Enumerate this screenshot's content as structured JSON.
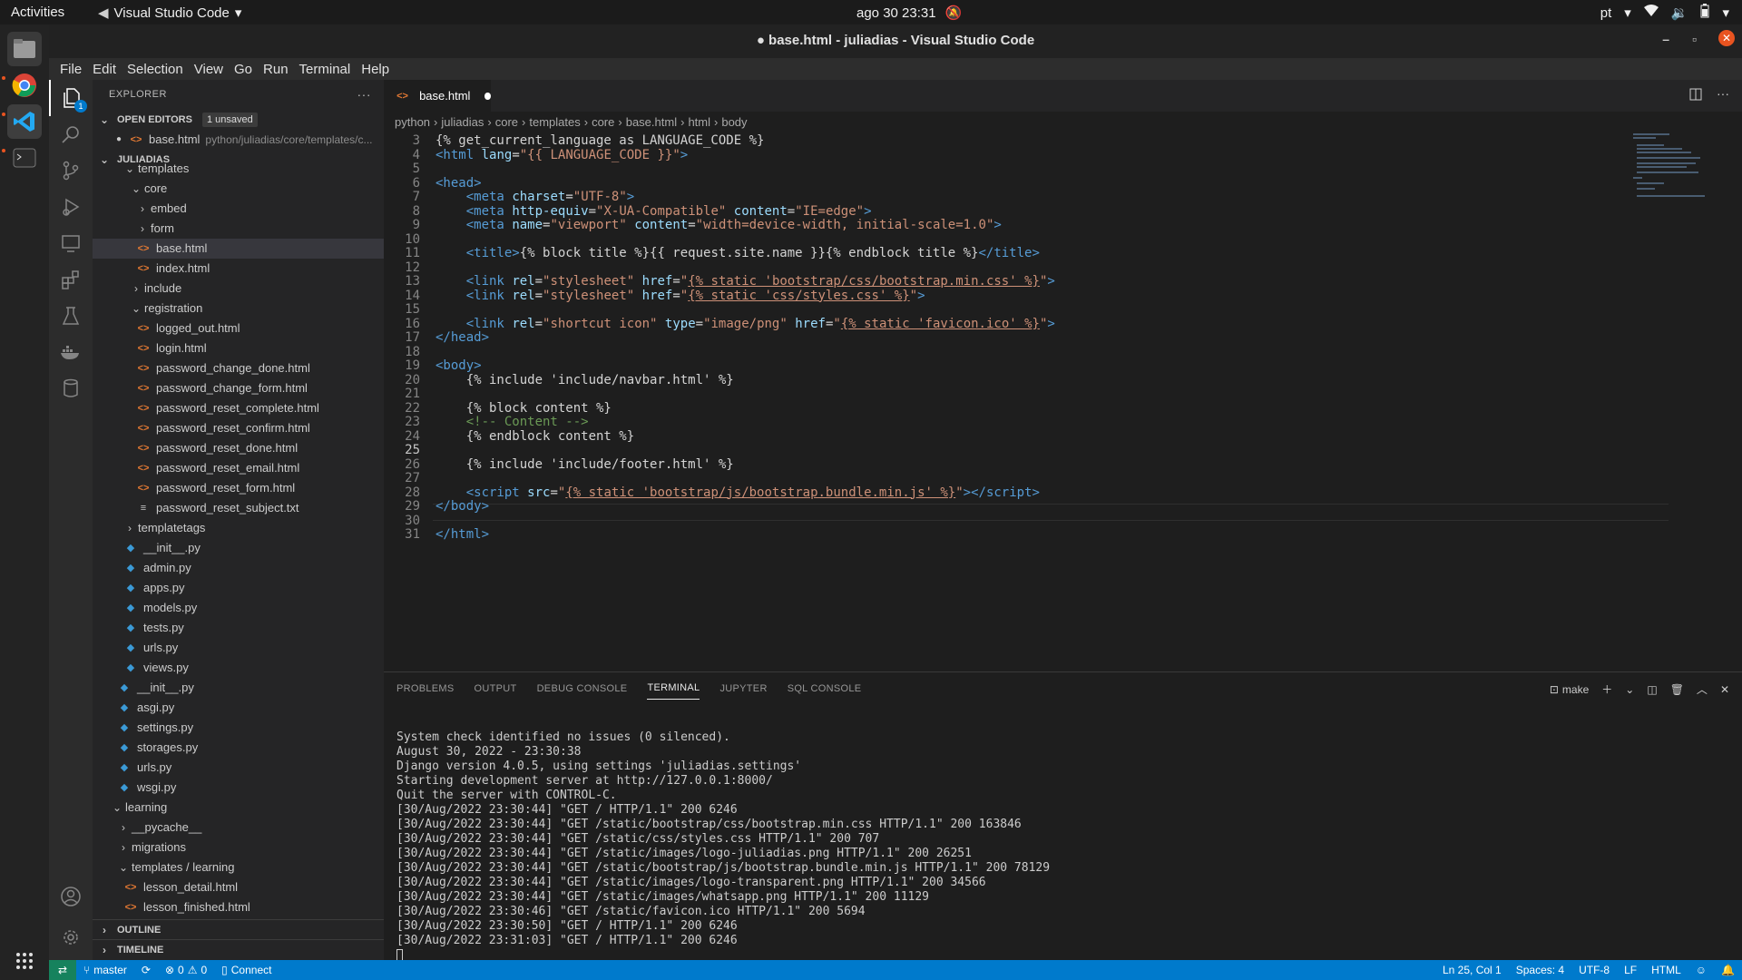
{
  "topbar": {
    "activities": "Activities",
    "app_name": "Visual Studio Code",
    "clock": "ago 30  23:31",
    "lang": "pt"
  },
  "window": {
    "title": "● base.html - juliadias - Visual Studio Code"
  },
  "menu": [
    "File",
    "Edit",
    "Selection",
    "View",
    "Go",
    "Run",
    "Terminal",
    "Help"
  ],
  "explorer": {
    "header": "EXPLORER",
    "open_editors_label": "OPEN EDITORS",
    "unsaved_badge": "1 unsaved",
    "open_file": "base.html",
    "open_file_path": "python/juliadias/core/templates/c...",
    "workspace_label": "JULIADIAS",
    "tree": [
      {
        "label": "templates",
        "kind": "folder-open",
        "depth": 2
      },
      {
        "label": "core",
        "kind": "folder-open",
        "depth": 3
      },
      {
        "label": "embed",
        "kind": "folder",
        "depth": 4
      },
      {
        "label": "form",
        "kind": "folder",
        "depth": 4
      },
      {
        "label": "base.html",
        "kind": "html",
        "depth": 4,
        "selected": true
      },
      {
        "label": "index.html",
        "kind": "html",
        "depth": 4
      },
      {
        "label": "include",
        "kind": "folder",
        "depth": 3
      },
      {
        "label": "registration",
        "kind": "folder-open",
        "depth": 3
      },
      {
        "label": "logged_out.html",
        "kind": "html",
        "depth": 4
      },
      {
        "label": "login.html",
        "kind": "html",
        "depth": 4
      },
      {
        "label": "password_change_done.html",
        "kind": "html",
        "depth": 4
      },
      {
        "label": "password_change_form.html",
        "kind": "html",
        "depth": 4
      },
      {
        "label": "password_reset_complete.html",
        "kind": "html",
        "depth": 4
      },
      {
        "label": "password_reset_confirm.html",
        "kind": "html",
        "depth": 4
      },
      {
        "label": "password_reset_done.html",
        "kind": "html",
        "depth": 4
      },
      {
        "label": "password_reset_email.html",
        "kind": "html",
        "depth": 4
      },
      {
        "label": "password_reset_form.html",
        "kind": "html",
        "depth": 4
      },
      {
        "label": "password_reset_subject.txt",
        "kind": "txt",
        "depth": 4
      },
      {
        "label": "templatetags",
        "kind": "folder",
        "depth": 2
      },
      {
        "label": "__init__.py",
        "kind": "py",
        "depth": 2
      },
      {
        "label": "admin.py",
        "kind": "py",
        "depth": 2
      },
      {
        "label": "apps.py",
        "kind": "py",
        "depth": 2
      },
      {
        "label": "models.py",
        "kind": "py",
        "depth": 2
      },
      {
        "label": "tests.py",
        "kind": "py",
        "depth": 2
      },
      {
        "label": "urls.py",
        "kind": "py",
        "depth": 2
      },
      {
        "label": "views.py",
        "kind": "py",
        "depth": 2
      },
      {
        "label": "__init__.py",
        "kind": "py",
        "depth": 1
      },
      {
        "label": "asgi.py",
        "kind": "py",
        "depth": 1
      },
      {
        "label": "settings.py",
        "kind": "py",
        "depth": 1
      },
      {
        "label": "storages.py",
        "kind": "py",
        "depth": 1
      },
      {
        "label": "urls.py",
        "kind": "py",
        "depth": 1
      },
      {
        "label": "wsgi.py",
        "kind": "py",
        "depth": 1
      },
      {
        "label": "learning",
        "kind": "folder-open",
        "depth": 0
      },
      {
        "label": "__pycache__",
        "kind": "folder",
        "depth": 1
      },
      {
        "label": "migrations",
        "kind": "folder",
        "depth": 1
      },
      {
        "label": "templates / learning",
        "kind": "folder-open",
        "depth": 1
      },
      {
        "label": "lesson_detail.html",
        "kind": "html",
        "depth": 2
      },
      {
        "label": "lesson_finished.html",
        "kind": "html",
        "depth": 2
      }
    ],
    "outline_label": "OUTLINE",
    "timeline_label": "TIMELINE"
  },
  "editor": {
    "tab_label": "base.html",
    "breadcrumbs": [
      "python",
      "juliadias",
      "core",
      "templates",
      "core",
      "base.html",
      "html",
      "body"
    ],
    "current_line": 25,
    "lines": [
      {
        "n": 3,
        "html": "{% get_current_language as LANGUAGE_CODE %}"
      },
      {
        "n": 4,
        "html": "<span class=\"t-tag\">&lt;html</span> <span class=\"t-attr\">lang</span>=<span class=\"t-str\">\"{{ LANGUAGE_CODE }}\"</span><span class=\"t-tag\">&gt;</span>"
      },
      {
        "n": 5,
        "html": ""
      },
      {
        "n": 6,
        "html": "<span class=\"t-tag\">&lt;head&gt;</span>"
      },
      {
        "n": 7,
        "html": "    <span class=\"t-tag\">&lt;meta</span> <span class=\"t-attr\">charset</span>=<span class=\"t-str\">\"UTF-8\"</span><span class=\"t-tag\">&gt;</span>"
      },
      {
        "n": 8,
        "html": "    <span class=\"t-tag\">&lt;meta</span> <span class=\"t-attr\">http-equiv</span>=<span class=\"t-str\">\"X-UA-Compatible\"</span> <span class=\"t-attr\">content</span>=<span class=\"t-str\">\"IE=edge\"</span><span class=\"t-tag\">&gt;</span>"
      },
      {
        "n": 9,
        "html": "    <span class=\"t-tag\">&lt;meta</span> <span class=\"t-attr\">name</span>=<span class=\"t-str\">\"viewport\"</span> <span class=\"t-attr\">content</span>=<span class=\"t-str\">\"width=device-width, initial-scale=1.0\"</span><span class=\"t-tag\">&gt;</span>"
      },
      {
        "n": 10,
        "html": ""
      },
      {
        "n": 11,
        "html": "    <span class=\"t-tag\">&lt;title&gt;</span>{% block title %}{{ request.site.name }}{% endblock title %}<span class=\"t-tag\">&lt;/title&gt;</span>"
      },
      {
        "n": 12,
        "html": ""
      },
      {
        "n": 13,
        "html": "    <span class=\"t-tag\">&lt;link</span> <span class=\"t-attr\">rel</span>=<span class=\"t-str\">\"stylesheet\"</span> <span class=\"t-attr\">href</span>=<span class=\"t-str\">\"</span><span class=\"t-ul\">{% static 'bootstrap/css/bootstrap.min.css' %}</span><span class=\"t-str\">\"</span><span class=\"t-tag\">&gt;</span>"
      },
      {
        "n": 14,
        "html": "    <span class=\"t-tag\">&lt;link</span> <span class=\"t-attr\">rel</span>=<span class=\"t-str\">\"stylesheet\"</span> <span class=\"t-attr\">href</span>=<span class=\"t-str\">\"</span><span class=\"t-ul\">{% static 'css/styles.css' %}</span><span class=\"t-str\">\"</span><span class=\"t-tag\">&gt;</span>"
      },
      {
        "n": 15,
        "html": ""
      },
      {
        "n": 16,
        "html": "    <span class=\"t-tag\">&lt;link</span> <span class=\"t-attr\">rel</span>=<span class=\"t-str\">\"shortcut icon\"</span> <span class=\"t-attr\">type</span>=<span class=\"t-str\">\"image/png\"</span> <span class=\"t-attr\">href</span>=<span class=\"t-str\">\"</span><span class=\"t-ul\">{% static 'favicon.ico' %}</span><span class=\"t-str\">\"</span><span class=\"t-tag\">&gt;</span>"
      },
      {
        "n": 17,
        "html": "<span class=\"t-tag\">&lt;/head&gt;</span>"
      },
      {
        "n": 18,
        "html": ""
      },
      {
        "n": 19,
        "html": "<span class=\"t-tag\">&lt;body&gt;</span>"
      },
      {
        "n": 20,
        "html": "    {% include 'include/navbar.html' %}"
      },
      {
        "n": 21,
        "html": ""
      },
      {
        "n": 22,
        "html": "    {% block content %}"
      },
      {
        "n": 23,
        "html": "    <span class=\"t-com\">&lt;!-- Content --&gt;</span>"
      },
      {
        "n": 24,
        "html": "    {% endblock content %}"
      },
      {
        "n": 25,
        "html": ""
      },
      {
        "n": 26,
        "html": "    {% include 'include/footer.html' %}"
      },
      {
        "n": 27,
        "html": ""
      },
      {
        "n": 28,
        "html": "    <span class=\"t-tag\">&lt;script</span> <span class=\"t-attr\">src</span>=<span class=\"t-str\">\"</span><span class=\"t-ul\">{% static 'bootstrap/js/bootstrap.bundle.min.js' %}</span><span class=\"t-str\">\"</span><span class=\"t-tag\">&gt;&lt;/script&gt;</span>"
      },
      {
        "n": 29,
        "html": "<span class=\"t-tag\">&lt;/body&gt;</span>"
      },
      {
        "n": 30,
        "html": ""
      },
      {
        "n": 31,
        "html": "<span class=\"t-tag\">&lt;/html&gt;</span>"
      }
    ]
  },
  "panel": {
    "tabs": [
      "PROBLEMS",
      "OUTPUT",
      "DEBUG CONSOLE",
      "TERMINAL",
      "JUPYTER",
      "SQL CONSOLE"
    ],
    "active_tab": "TERMINAL",
    "terminal_name": "make",
    "terminal_lines": [
      "System check identified no issues (0 silenced).",
      "August 30, 2022 - 23:30:38",
      "Django version 4.0.5, using settings 'juliadias.settings'",
      "Starting development server at http://127.0.0.1:8000/",
      "Quit the server with CONTROL-C.",
      "[30/Aug/2022 23:30:44] \"GET / HTTP/1.1\" 200 6246",
      "[30/Aug/2022 23:30:44] \"GET /static/bootstrap/css/bootstrap.min.css HTTP/1.1\" 200 163846",
      "[30/Aug/2022 23:30:44] \"GET /static/css/styles.css HTTP/1.1\" 200 707",
      "[30/Aug/2022 23:30:44] \"GET /static/images/logo-juliadias.png HTTP/1.1\" 200 26251",
      "[30/Aug/2022 23:30:44] \"GET /static/bootstrap/js/bootstrap.bundle.min.js HTTP/1.1\" 200 78129",
      "[30/Aug/2022 23:30:44] \"GET /static/images/logo-transparent.png HTTP/1.1\" 200 34566",
      "[30/Aug/2022 23:30:44] \"GET /static/images/whatsapp.png HTTP/1.1\" 200 11129",
      "[30/Aug/2022 23:30:46] \"GET /static/favicon.ico HTTP/1.1\" 200 5694",
      "[30/Aug/2022 23:30:50] \"GET / HTTP/1.1\" 200 6246",
      "[30/Aug/2022 23:31:03] \"GET / HTTP/1.1\" 200 6246"
    ]
  },
  "status": {
    "branch": "master",
    "errors": "0",
    "warnings": "0",
    "connect": "Connect",
    "position": "Ln 25, Col 1",
    "spaces": "Spaces: 4",
    "encoding": "UTF-8",
    "eol": "LF",
    "language": "HTML"
  },
  "colors": {
    "statusbar": "#007acc",
    "remote": "#16825d",
    "html_icon": "#e37933",
    "py_icon": "#3b9ad6"
  }
}
